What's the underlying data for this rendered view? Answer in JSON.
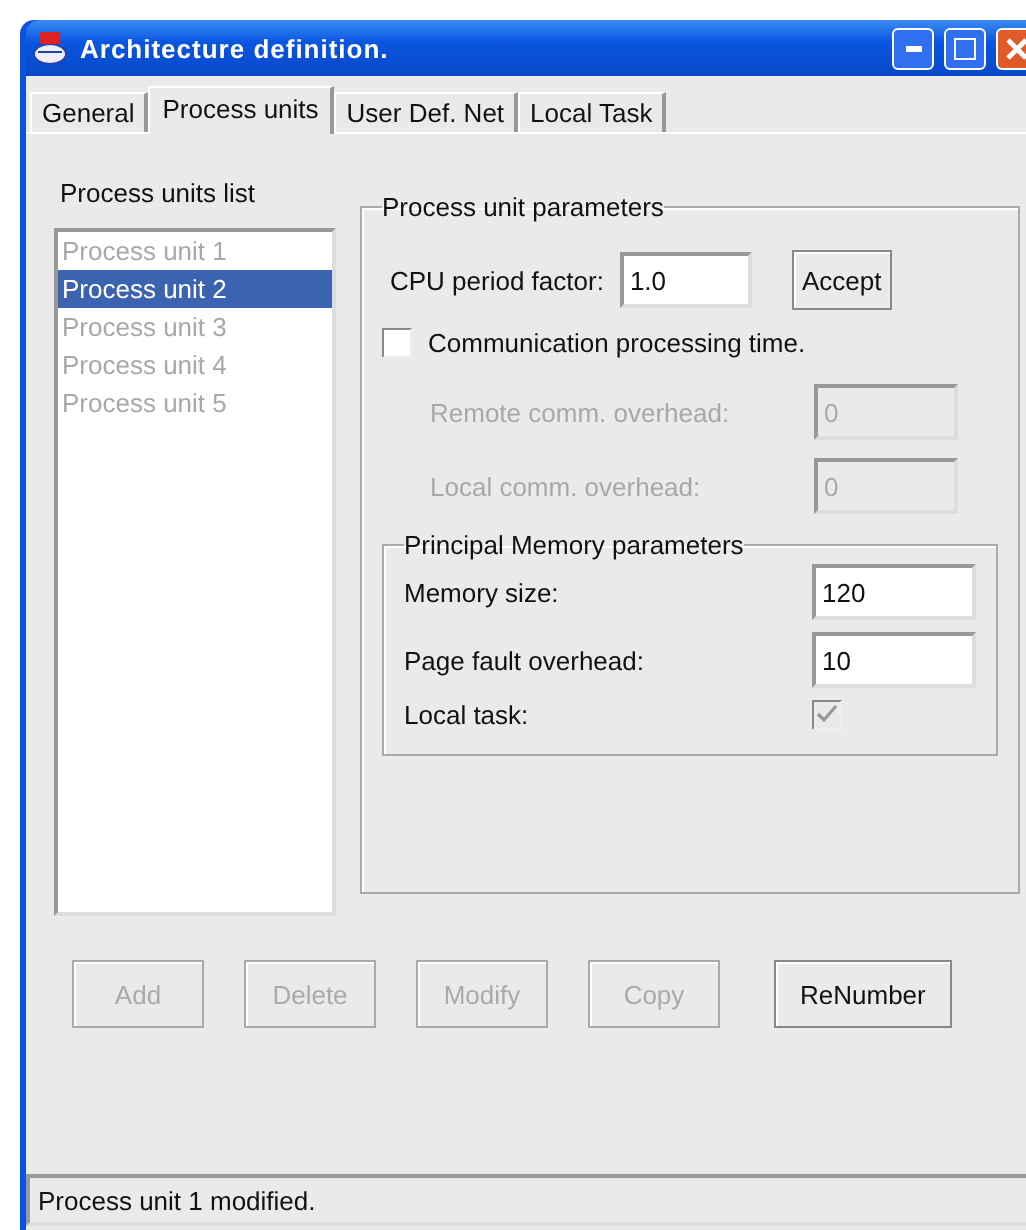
{
  "window": {
    "title": "Architecture definition."
  },
  "tabs": [
    {
      "label": "General",
      "selected": false
    },
    {
      "label": "Process units",
      "selected": true
    },
    {
      "label": "User Def. Net",
      "selected": false
    },
    {
      "label": "Local Task",
      "selected": false
    }
  ],
  "list": {
    "title": "Process units list",
    "items": [
      {
        "label": "Process unit 1",
        "selected": false,
        "disabled": true
      },
      {
        "label": "Process unit 2",
        "selected": true,
        "disabled": false
      },
      {
        "label": "Process unit 3",
        "selected": false,
        "disabled": true
      },
      {
        "label": "Process unit 4",
        "selected": false,
        "disabled": true
      },
      {
        "label": "Process unit 5",
        "selected": false,
        "disabled": true
      }
    ]
  },
  "parameters": {
    "title": "Process unit parameters",
    "cpu_label": "CPU period factor:",
    "cpu_value": "1.0",
    "accept": "Accept",
    "communication": {
      "label": "Communication processing time.",
      "checked": false
    },
    "overheads": [
      {
        "label": "Remote comm. overhead:",
        "value": "0",
        "disabled": true
      },
      {
        "label": "Local comm. overhead:",
        "value": "0",
        "disabled": true
      }
    ],
    "memory": {
      "title": "Principal Memory parameters",
      "fields": [
        {
          "label": "Memory size:",
          "value": "120"
        },
        {
          "label": "Page fault overhead:",
          "value": "10"
        }
      ],
      "local_task": {
        "label": "Local task:",
        "checked": true,
        "disabled": true
      }
    }
  },
  "buttons": [
    {
      "label": "Add",
      "disabled": true
    },
    {
      "label": "Delete",
      "disabled": true
    },
    {
      "label": "Modify",
      "disabled": true
    },
    {
      "label": "Copy",
      "disabled": true
    },
    {
      "label": "ReNumber",
      "disabled": false
    }
  ],
  "status_bar": "Process unit 1 modified."
}
